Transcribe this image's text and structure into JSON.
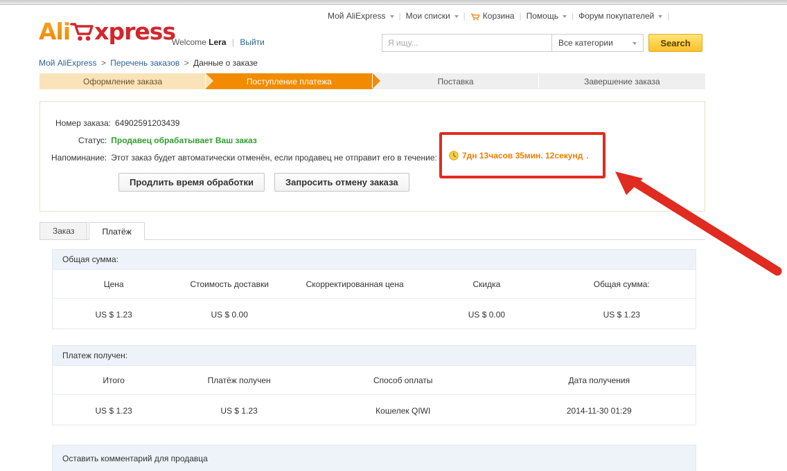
{
  "topnav": {
    "items": [
      {
        "label": "Мой AliExpress",
        "icon": "",
        "caret": true
      },
      {
        "label": "Мои списки",
        "icon": "",
        "caret": true
      },
      {
        "label": "Корзина",
        "icon": "cart-icon",
        "caret": false
      },
      {
        "label": "Помощь",
        "icon": "",
        "caret": true
      },
      {
        "label": "Форум покупателей",
        "icon": "",
        "caret": true
      }
    ]
  },
  "logo": {
    "part1": "Ali",
    "icon": "shopping-cart-icon",
    "part2": "xpress"
  },
  "welcome": {
    "greeting": "Welcome",
    "username": "Lera",
    "signout": "Выйти"
  },
  "search": {
    "placeholder": "Я ищу...",
    "value": "",
    "category": "Все категории",
    "button": "Search"
  },
  "breadcrumb": {
    "item1": "Мой AliExpress",
    "item2": "Перечень заказов",
    "current": "Данные о заказе"
  },
  "steps": [
    {
      "label": "Оформление заказа",
      "state": "done"
    },
    {
      "label": "Поступление платежа",
      "state": "active"
    },
    {
      "label": "Поставка",
      "state": "pending"
    },
    {
      "label": "Завершение заказа",
      "state": "pending"
    }
  ],
  "order": {
    "number_label": "Номер заказа:",
    "number_value": "64902591203439",
    "status_label": "Статус:",
    "status_value": "Продавец обрабатывает Ваш заказ",
    "reminder_label": "Напоминание:",
    "reminder_value": "Этот заказ будет автоматически отменён, если продавец не отправит его в течение:",
    "timer": "7дн 13часов 35мин. 12секунд",
    "timer_trail": ".",
    "extend_button": "Продлить время обработки",
    "cancel_button": "Запросить отмену заказа"
  },
  "tabs": [
    {
      "label": "Заказ",
      "active": false
    },
    {
      "label": "Платёж",
      "active": true
    }
  ],
  "total_panel": {
    "title": "Общая сумма:",
    "headers": [
      "Цена",
      "Стоимость доставки",
      "Скорректированная цена",
      "Скидка",
      "Общая сумма:"
    ],
    "row": [
      "US $ 1.23",
      "US $ 0.00",
      "",
      "US $ 0.00",
      "US $ 1.23"
    ]
  },
  "received_panel": {
    "title": "Платеж получен:",
    "headers": [
      "Итого",
      "Платёж получен",
      "Способ оплаты",
      "Дата получения"
    ],
    "row": [
      "US $ 1.23",
      "US $ 1.23",
      "Кошелек QIWI",
      "2014-11-30 01:29"
    ]
  },
  "comment_panel": {
    "title": "Оставить комментарий для продавца"
  },
  "colors": {
    "brand_orange": "#f28b00",
    "brand_red": "#d3262c",
    "status_green": "#2f9e2f",
    "timer_orange": "#f07d00",
    "annotation_red": "#e02b20",
    "panel_head_blue": "#edf3f9"
  }
}
